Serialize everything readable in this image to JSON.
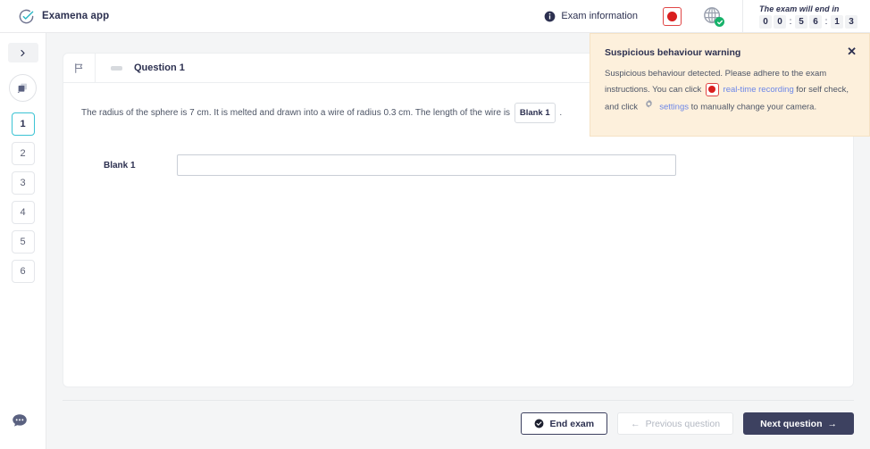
{
  "brand": {
    "name": "Examena app",
    "logo_icon": "circle-check-icon"
  },
  "header": {
    "exam_info_label": "Exam information",
    "info_icon": "info-circle-icon",
    "record_icon": "record-button-icon",
    "camera_icon": "camera-status-icon",
    "camera_status": "ok",
    "timer_label": "The exam will end in",
    "timer_digits": [
      "0",
      "0",
      ":",
      "5",
      "6",
      ":",
      "1",
      "3"
    ],
    "timer_value": "00:56:13"
  },
  "sidebar": {
    "collapse_icon": "chevron-right-icon",
    "palette_icon": "question-palette-icon",
    "questions": [
      {
        "label": "1",
        "active": true
      },
      {
        "label": "2",
        "active": false
      },
      {
        "label": "3",
        "active": false
      },
      {
        "label": "4",
        "active": false
      },
      {
        "label": "5",
        "active": false
      },
      {
        "label": "6",
        "active": false
      }
    ],
    "chat_icon": "chat-bubble-icon"
  },
  "question": {
    "flag_icon": "flag-icon",
    "title": "Question 1",
    "text_part1": "The radius of the sphere is 7 cm. It is melted and drawn into a wire of radius 0.3 cm. The length of the wire is",
    "blank_chip": "Blank 1",
    "text_part2": ".",
    "answer_label": "Blank 1",
    "answer_value": "",
    "answer_placeholder": ""
  },
  "footer": {
    "end_exam": "End exam",
    "end_exam_icon": "check-circle-icon",
    "previous_question": "Previous question",
    "previous_icon": "arrow-left-icon",
    "next_question": "Next question",
    "next_icon": "arrow-right-icon"
  },
  "toast": {
    "title": "Suspicious behaviour warning",
    "close_icon": "close-icon",
    "body_1": "Suspicious behaviour detected. Please adhere to the exam instructions. You can click",
    "link_recording": "real-time recording",
    "body_2": "for self check, and click",
    "link_settings": "settings",
    "body_3": "to manually change your camera.",
    "rec_icon": "record-button-icon",
    "gear_icon": "gear-icon"
  },
  "colors": {
    "accent_dark": "#3d4160",
    "active_teal": "#3bc3d4",
    "warning_bg": "#fdf0dc",
    "record_red": "#d91f1f",
    "link_blue": "#6b86e8",
    "status_green": "#17b26a"
  }
}
